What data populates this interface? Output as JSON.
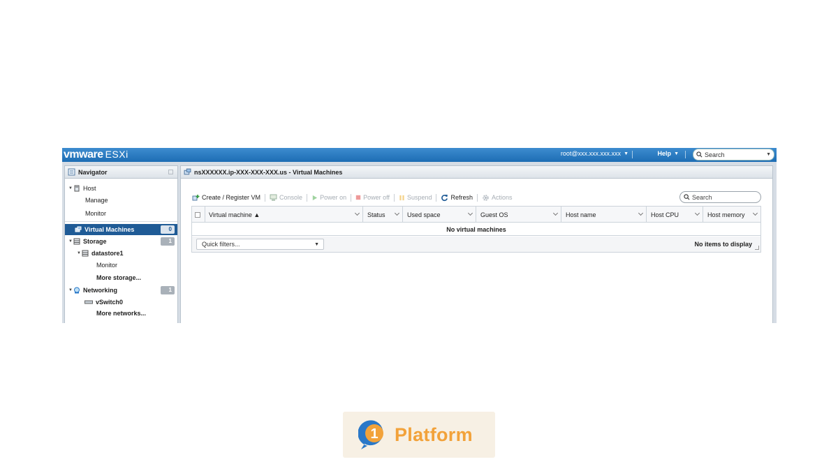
{
  "header": {
    "brand_vm": "vmware",
    "brand_product": "ESXi",
    "user": "root@xxx.xxx.xxx.xxx",
    "help": "Help",
    "search_placeholder": "Search"
  },
  "navigator": {
    "title": "Navigator",
    "items": [
      {
        "label": "Host",
        "icon": "host-icon"
      },
      {
        "label": "Manage"
      },
      {
        "label": "Monitor"
      },
      {
        "label": "Virtual Machines",
        "badge": "0",
        "selected": true,
        "icon": "vm-icon"
      },
      {
        "label": "Storage",
        "badge": "1",
        "icon": "storage-icon"
      },
      {
        "label": "datastore1",
        "icon": "datastore-icon"
      },
      {
        "label": "Monitor"
      },
      {
        "label": "More storage..."
      },
      {
        "label": "Networking",
        "badge": "1",
        "icon": "network-icon"
      },
      {
        "label": "vSwitch0",
        "icon": "switch-icon"
      },
      {
        "label": "More networks..."
      }
    ]
  },
  "main": {
    "title": "nsXXXXXX.ip-XXX-XXX-XXX.us - Virtual Machines",
    "toolbar": {
      "create": "Create / Register VM",
      "console": "Console",
      "power_on": "Power on",
      "power_off": "Power off",
      "suspend": "Suspend",
      "refresh": "Refresh",
      "actions": "Actions",
      "search_placeholder": "Search"
    },
    "columns": [
      "Virtual machine ▲",
      "Status",
      "Used space",
      "Guest OS",
      "Host name",
      "Host CPU",
      "Host memory"
    ],
    "empty_text": "No virtual machines",
    "quick_filters": "Quick filters...",
    "no_items": "No items to display"
  },
  "watermark": {
    "text": "Platform",
    "badge_digit": "1"
  },
  "colors": {
    "topbar": "#1d6db4",
    "selected": "#1f5b96",
    "brand_orange": "#f2a23a",
    "brand_blue": "#2a78c8"
  }
}
